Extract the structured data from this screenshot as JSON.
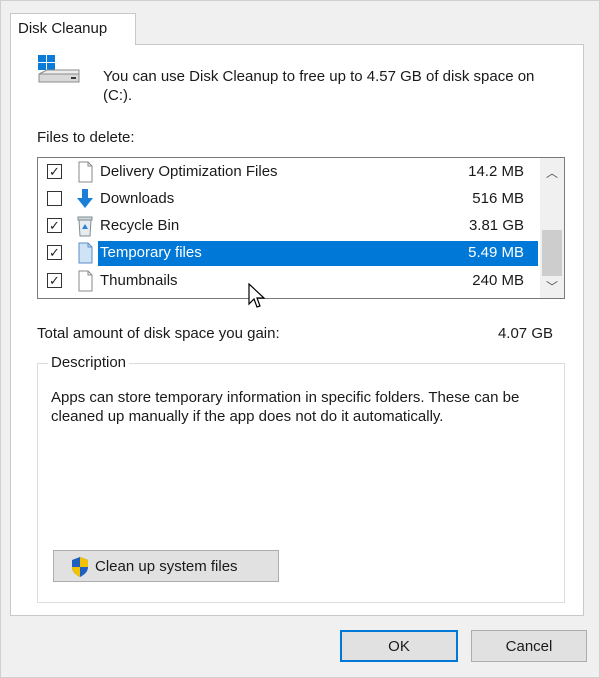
{
  "tab": {
    "label": "Disk Cleanup"
  },
  "intro": {
    "text": "You can use Disk Cleanup to free up to 4.57 GB of disk space on  (C:)."
  },
  "files": {
    "label": "Files to delete:",
    "items": [
      {
        "name": "Delivery Optimization Files",
        "size": "14.2 MB",
        "checked": true,
        "icon": "file-icon",
        "selected": false
      },
      {
        "name": "Downloads",
        "size": "516 MB",
        "checked": false,
        "icon": "download-arrow-icon",
        "selected": false
      },
      {
        "name": "Recycle Bin",
        "size": "3.81 GB",
        "checked": true,
        "icon": "recycle-bin-icon",
        "selected": false
      },
      {
        "name": "Temporary files",
        "size": "5.49 MB",
        "checked": true,
        "icon": "file-icon",
        "selected": true
      },
      {
        "name": "Thumbnails",
        "size": "240 MB",
        "checked": true,
        "icon": "file-icon",
        "selected": false
      }
    ]
  },
  "total": {
    "label": "Total amount of disk space you gain:",
    "value": "4.07 GB"
  },
  "description": {
    "title": "Description",
    "text": "Apps can store temporary information in specific folders. These can be cleaned up manually if the app does not do it automatically."
  },
  "buttons": {
    "clean_system": "Clean up system files",
    "ok": "OK",
    "cancel": "Cancel"
  },
  "colors": {
    "selection": "#0078d7",
    "windows_logo": "#0a7bd6",
    "shield_blue": "#1f5fbf",
    "shield_yellow": "#f2c100"
  }
}
